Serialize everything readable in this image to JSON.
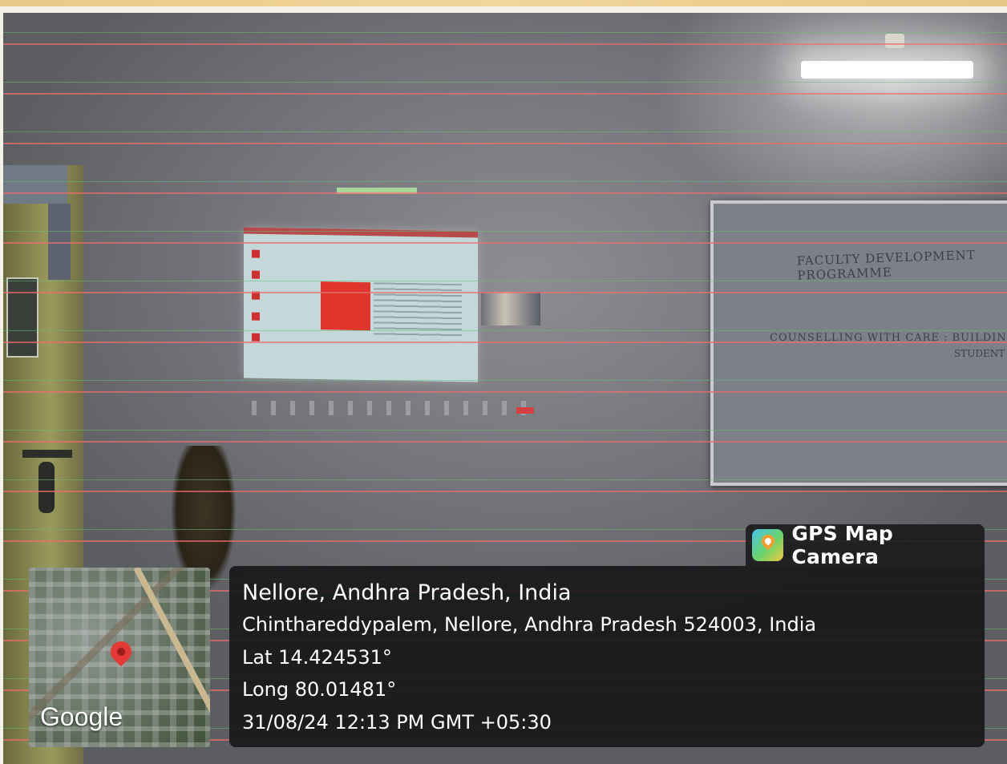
{
  "overlay": {
    "app_name": "GPS Map Camera",
    "city_line": "Nellore, Andhra Pradesh, India",
    "address": "Chinthareddypalem, Nellore, Andhra Pradesh 524003, India",
    "latitude": "Lat 14.424531°",
    "longitude": "Long 80.01481°",
    "datetime": "31/08/24 12:13 PM GMT +05:30",
    "map_provider": "Google"
  },
  "whiteboard": {
    "line1": "FACULTY DEVELOPMENT PROGRAMME",
    "line2": "COUNSELLING WITH CARE : BUILDING BRIDGES",
    "line3": "STUDENT R"
  },
  "colors": {
    "overlay_bg": "#161618",
    "map_pin": "#e53935",
    "scanline_green": "#62be78",
    "scanline_red": "#ee6c70"
  },
  "icons": [
    "gps-map-camera-icon",
    "location-pin-icon"
  ]
}
